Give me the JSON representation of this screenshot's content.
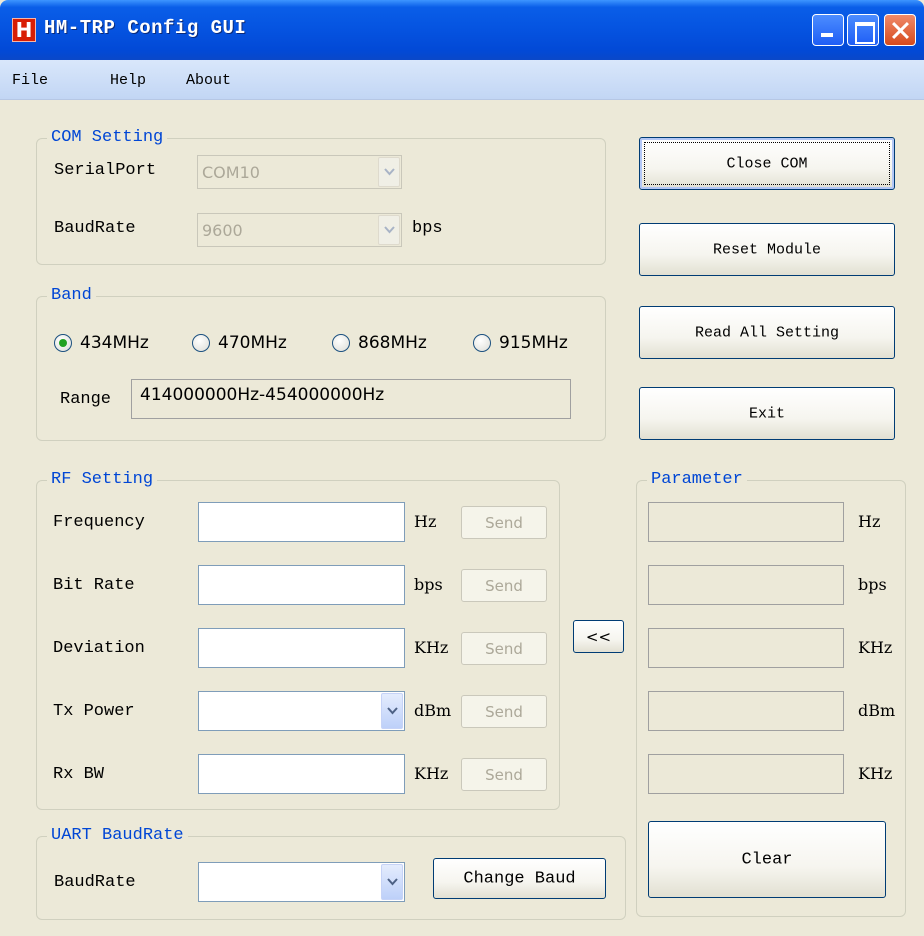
{
  "window": {
    "title": "HM-TRP Config GUI",
    "icon_glyph": "H"
  },
  "menu": [
    "File",
    "Help",
    "About"
  ],
  "com_setting": {
    "title": "COM Setting",
    "serial_port_label": "SerialPort",
    "serial_port_value": "COM10",
    "baud_label": "BaudRate",
    "baud_value": "9600",
    "baud_unit": "bps"
  },
  "band": {
    "title": "Band",
    "options": [
      "434MHz",
      "470MHz",
      "868MHz",
      "915MHz"
    ],
    "selected": "434MHz",
    "range_label": "Range",
    "range_value": "414000000Hz-454000000Hz"
  },
  "buttons": {
    "close_com": "Close COM",
    "reset_module": "Reset Module",
    "read_all": "Read  All Setting",
    "exit": "Exit",
    "copy_params": "<<",
    "clear": "Clear",
    "change_baud": "Change Baud"
  },
  "rf_setting": {
    "title": "RF Setting",
    "rows": [
      {
        "label": "Frequency",
        "unit": "Hz",
        "send": "Send",
        "value": ""
      },
      {
        "label": "Bit Rate",
        "unit": "bps",
        "send": "Send",
        "value": ""
      },
      {
        "label": "Deviation",
        "unit": "KHz",
        "send": "Send",
        "value": ""
      },
      {
        "label": "Tx Power",
        "unit": "dBm",
        "send": "Send",
        "value": ""
      },
      {
        "label": "Rx BW",
        "unit": "KHz",
        "send": "Send",
        "value": ""
      }
    ]
  },
  "parameter": {
    "title": "Parameter",
    "units": [
      "Hz",
      "bps",
      "KHz",
      "dBm",
      "KHz"
    ]
  },
  "uart": {
    "title": "UART BaudRate",
    "baud_label": "BaudRate",
    "baud_value": ""
  },
  "colors": {
    "titlebar": "#0553e0",
    "group_title": "#0046d5",
    "face": "#ece9d8"
  }
}
